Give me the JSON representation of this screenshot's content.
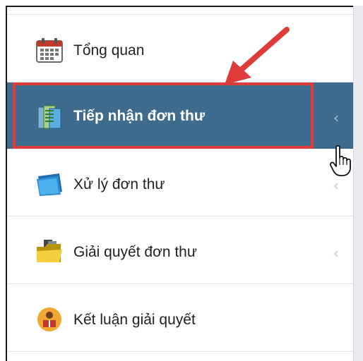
{
  "menu": {
    "items": [
      {
        "label": "Tổng quan",
        "icon": "calendar-icon",
        "has_chevron": false
      },
      {
        "label": "Tiếp nhận đơn thư",
        "icon": "documents-icon",
        "has_chevron": true,
        "active": true
      },
      {
        "label": "Xử lý đơn thư",
        "icon": "blue-folder-icon",
        "has_chevron": true
      },
      {
        "label": "Giải quyết đơn thư",
        "icon": "yellow-folder-icon",
        "has_chevron": true
      },
      {
        "label": "Kết luận giải quyết",
        "icon": "reader-icon",
        "has_chevron": false
      }
    ],
    "chevron": "‹"
  },
  "colors": {
    "active_bg": "#3e6b8e",
    "highlight": "#e03b3b",
    "arrow": "#e03b3b"
  }
}
